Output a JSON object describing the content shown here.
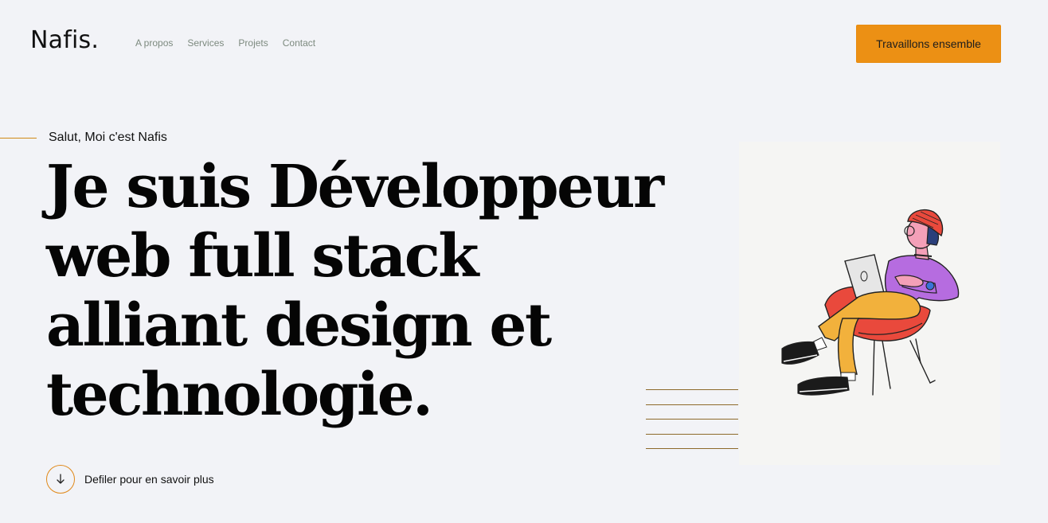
{
  "header": {
    "logo": "Nafis.",
    "nav": [
      "A propos",
      "Services",
      "Projets",
      "Contact"
    ],
    "cta_label": "Travaillons ensemble"
  },
  "hero": {
    "intro": "Salut, Moi c'est Nafis",
    "headline_lines": [
      "Je suis Développeur",
      "web full stack",
      "alliant design et",
      "technologie."
    ],
    "scroll_label": "Defiler pour en savoir plus",
    "scroll_icon": "arrow-down-icon",
    "illustration": "person-with-laptop-in-chair"
  },
  "colors": {
    "background": "#f2f3f7",
    "accent": "#ec9014",
    "nav_text": "#7d8a7f",
    "headline": "#050505"
  }
}
